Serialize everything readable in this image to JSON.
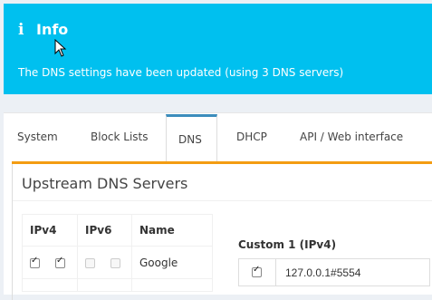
{
  "alert": {
    "icon": "i",
    "title": "Info",
    "message": "The DNS settings have been updated (using 3 DNS servers)"
  },
  "tabs": [
    {
      "label": "System"
    },
    {
      "label": "Block Lists"
    },
    {
      "label": "DNS"
    },
    {
      "label": "DHCP"
    },
    {
      "label": "API / Web interface"
    }
  ],
  "active_tab": "DNS",
  "upstream": {
    "title": "Upstream DNS Servers",
    "columns": {
      "ipv4": "IPv4",
      "ipv6": "IPv6",
      "name": "Name"
    },
    "rows": [
      {
        "ipv4_checked": [
          true,
          true
        ],
        "ipv6_checked": [
          false,
          false
        ],
        "name": "Google"
      }
    ]
  },
  "custom": {
    "label": "Custom 1 (IPv4)",
    "checked": true,
    "value": "127.0.0.1#5554"
  },
  "colors": {
    "alert_bg": "#00c0ef",
    "tab_accent": "#3c8dbc",
    "box_accent": "#f39c12"
  }
}
